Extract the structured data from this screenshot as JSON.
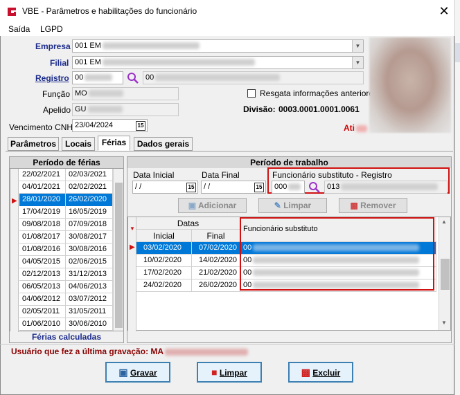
{
  "app": {
    "title": "VBE - Parâmetros e habilitações do funcionário",
    "close": "✕"
  },
  "menu": [
    "Saída",
    "LGPD"
  ],
  "form": {
    "empresa_label": "Empresa",
    "empresa_value": "001 EM",
    "filial_label": "Filial",
    "filial_value": "001 EM",
    "registro_label": "Registro",
    "registro_value": "00",
    "registro_name": "00",
    "funcao_label": "Função",
    "funcao_value": "MO",
    "apelido_label": "Apelido",
    "apelido_value": "GU",
    "resgata_label": "Resgata informações anteriores",
    "divisao_label": "Divisão:",
    "divisao_value": "0003.0001.0001.0061",
    "vencimento_label": "Vencimento  CNH",
    "vencimento_value": "23/04/2024",
    "status": "Ati"
  },
  "tabs": [
    "Parâmetros",
    "Locais",
    "Férias",
    "Dados gerais"
  ],
  "ferias": {
    "header": "Período de férias",
    "rows": [
      [
        "22/02/2021",
        "02/03/2021"
      ],
      [
        "04/01/2021",
        "02/02/2021"
      ],
      [
        "28/01/2020",
        "26/02/2020"
      ],
      [
        "17/04/2019",
        "16/05/2019"
      ],
      [
        "09/08/2018",
        "07/09/2018"
      ],
      [
        "01/08/2017",
        "30/08/2017"
      ],
      [
        "01/08/2016",
        "30/08/2016"
      ],
      [
        "04/05/2015",
        "02/06/2015"
      ],
      [
        "02/12/2013",
        "31/12/2013"
      ],
      [
        "06/05/2013",
        "04/06/2013"
      ],
      [
        "04/06/2012",
        "03/07/2012"
      ],
      [
        "02/05/2011",
        "31/05/2011"
      ],
      [
        "01/06/2010",
        "30/06/2010"
      ]
    ],
    "footer": "Férias calculadas"
  },
  "trabalho": {
    "header": "Período de trabalho",
    "data_inicial_label": "Data Inicial",
    "data_inicial_value": " / /",
    "data_final_label": "Data Final",
    "data_final_value": " / /",
    "substituto_label": "Funcionário substituto - Registro",
    "substituto_reg": "000",
    "substituto_name": "013",
    "btn_adicionar": "Adicionar",
    "btn_limpar": "Limpar",
    "btn_remover": "Remover",
    "col_datas": "Datas",
    "col_inicial": "Inicial",
    "col_final": "Final",
    "col_substituto": "Funcionário substituto",
    "rows": [
      [
        "03/02/2020",
        "07/02/2020",
        "00"
      ],
      [
        "10/02/2020",
        "14/02/2020",
        "00"
      ],
      [
        "17/02/2020",
        "21/02/2020",
        "00"
      ],
      [
        "24/02/2020",
        "26/02/2020",
        "00"
      ]
    ]
  },
  "footer": {
    "ultima_label": "Usuário que fez a última gravação: MA",
    "gravar": "Gravar",
    "limpar": "Limpar",
    "excluir": "Excluir"
  },
  "colors": {
    "accent": "#0078d7",
    "label_blue": "#1a2a8a",
    "highlight_red": "#d01010"
  }
}
